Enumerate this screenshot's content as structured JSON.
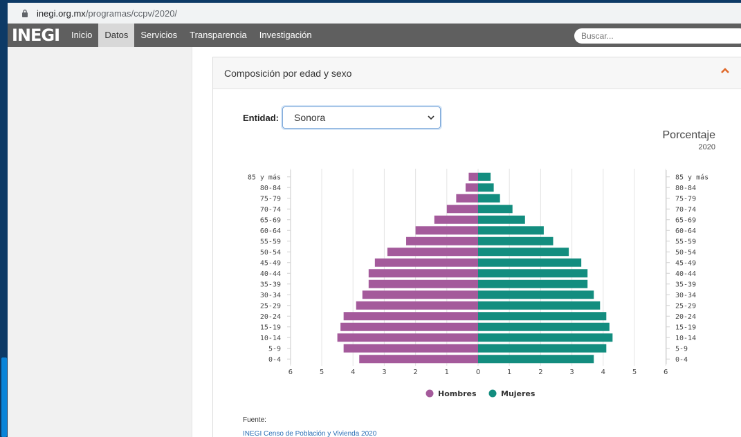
{
  "browser": {
    "url_host": "inegi.org.mx",
    "url_path": "/programas/ccpv/2020/"
  },
  "navbar": {
    "brand": "INEGI",
    "items": [
      {
        "label": "Inicio",
        "active": false
      },
      {
        "label": "Datos",
        "active": true
      },
      {
        "label": "Servicios",
        "active": false
      },
      {
        "label": "Transparencia",
        "active": false
      },
      {
        "label": "Investigación",
        "active": false
      }
    ],
    "search_placeholder": "Buscar..."
  },
  "panel": {
    "title": "Composición por edad y sexo",
    "collapse_icon": "chevron-up-icon",
    "entidad_label": "Entidad:",
    "entidad_value": "Sonora",
    "porcentaje_label": "Porcentaje",
    "year_label": "2020",
    "fuente_label": "Fuente:",
    "fuente_link": "INEGI Censo de Población y Vivienda 2020"
  },
  "colors": {
    "hombres": "#a45a9b",
    "mujeres": "#138d7f",
    "accent": "#e0692a"
  },
  "chart_data": {
    "type": "bar",
    "orientation": "horizontal-pyramid",
    "categories": [
      "85 y más",
      "80-84",
      "75-79",
      "70-74",
      "65-69",
      "60-64",
      "55-59",
      "50-54",
      "45-49",
      "40-44",
      "35-39",
      "30-34",
      "25-29",
      "20-24",
      "15-19",
      "10-14",
      "5-9",
      "0-4"
    ],
    "series": [
      {
        "name": "Hombres",
        "side": "left",
        "values": [
          0.3,
          0.4,
          0.7,
          1.0,
          1.4,
          2.0,
          2.3,
          2.9,
          3.3,
          3.5,
          3.5,
          3.7,
          3.9,
          4.3,
          4.4,
          4.5,
          4.3,
          3.8
        ]
      },
      {
        "name": "Mujeres",
        "side": "right",
        "values": [
          0.4,
          0.5,
          0.7,
          1.1,
          1.5,
          2.1,
          2.4,
          2.9,
          3.3,
          3.5,
          3.5,
          3.7,
          3.9,
          4.1,
          4.2,
          4.3,
          4.1,
          3.7
        ]
      }
    ],
    "xticks": [
      "6",
      "5",
      "4",
      "3",
      "2",
      "1",
      "0",
      "1",
      "2",
      "3",
      "4",
      "5",
      "6"
    ],
    "xlim": [
      -6,
      6
    ],
    "grid": true,
    "legend": "bottom-center"
  }
}
